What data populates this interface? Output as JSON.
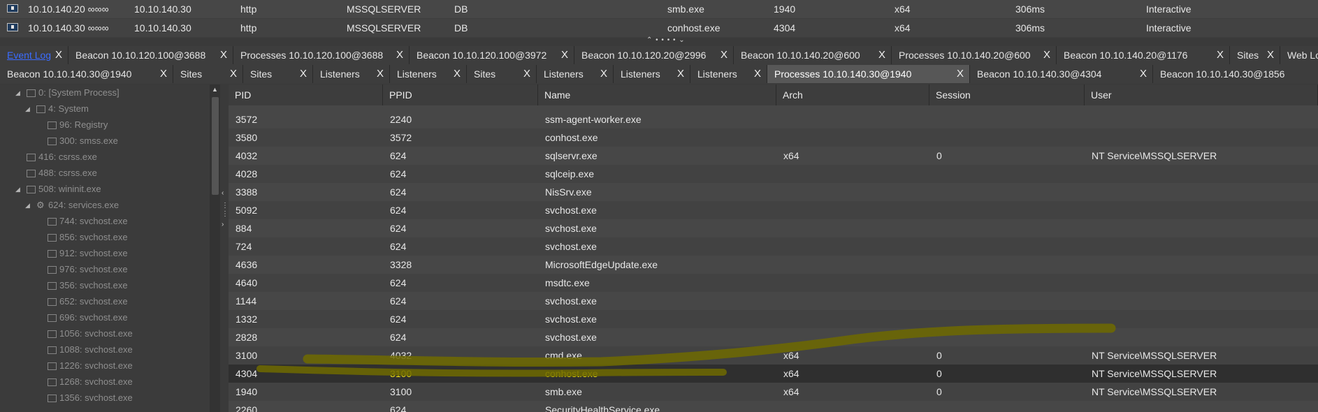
{
  "beacons": [
    {
      "external": "10.10.140.20 ∞∞∞",
      "internal": "10.10.140.30",
      "listener": "http",
      "user": "MSSQLSERVER",
      "computer": "DB",
      "process": "smb.exe",
      "pid": "1940",
      "arch": "x64",
      "last": "306ms",
      "note": "Interactive"
    },
    {
      "external": "10.10.140.30 ∞∞∞",
      "internal": "10.10.140.30",
      "listener": "http",
      "user": "MSSQLSERVER",
      "computer": "DB",
      "process": "conhost.exe",
      "pid": "4304",
      "arch": "x64",
      "last": "306ms",
      "note": "Interactive"
    }
  ],
  "splitter_grip": "⌃ • • • • ⌄",
  "tabs_row1": [
    {
      "label": "Event Log"
    },
    {
      "label": "Beacon 10.10.120.100@3688"
    },
    {
      "label": "Processes 10.10.120.100@3688"
    },
    {
      "label": "Beacon 10.10.120.100@3972"
    },
    {
      "label": "Beacon 10.10.120.20@2996"
    },
    {
      "label": "Beacon 10.10.140.20@600"
    },
    {
      "label": "Processes 10.10.140.20@600"
    },
    {
      "label": "Beacon 10.10.140.20@1176"
    },
    {
      "label": "Sites"
    },
    {
      "label": "Web Log"
    }
  ],
  "tabs_row2": [
    {
      "label": "Beacon 10.10.140.30@1940"
    },
    {
      "label": "Sites"
    },
    {
      "label": "Sites"
    },
    {
      "label": "Listeners"
    },
    {
      "label": "Listeners"
    },
    {
      "label": "Sites"
    },
    {
      "label": "Listeners"
    },
    {
      "label": "Listeners"
    },
    {
      "label": "Listeners"
    },
    {
      "label": "Processes 10.10.140.30@1940"
    },
    {
      "label": "Beacon 10.10.140.30@4304"
    },
    {
      "label": "Beacon 10.10.140.30@1856"
    }
  ],
  "close_glyph": "X",
  "tree": [
    {
      "label": "0: [System Process]",
      "expanded": true
    },
    {
      "label": "4: System",
      "expanded": true
    },
    {
      "label": "96: Registry"
    },
    {
      "label": "300: smss.exe"
    },
    {
      "label": "416: csrss.exe"
    },
    {
      "label": "488: csrss.exe"
    },
    {
      "label": "508: wininit.exe",
      "expanded": true
    },
    {
      "label": "624: services.exe",
      "expanded": true,
      "icon": "gear-icon"
    },
    {
      "label": "744: svchost.exe"
    },
    {
      "label": "856: svchost.exe"
    },
    {
      "label": "912: svchost.exe"
    },
    {
      "label": "976: svchost.exe"
    },
    {
      "label": "356: svchost.exe"
    },
    {
      "label": "652: svchost.exe"
    },
    {
      "label": "696: svchost.exe"
    },
    {
      "label": "1056: svchost.exe"
    },
    {
      "label": "1088: svchost.exe"
    },
    {
      "label": "1226: svchost.exe"
    },
    {
      "label": "1268: svchost.exe"
    },
    {
      "label": "1356: svchost.exe"
    }
  ],
  "process_columns": [
    "PID",
    "PPID",
    "Name",
    "Arch",
    "Session",
    "User"
  ],
  "processes": [
    {
      "pid": "3572",
      "ppid": "2240",
      "name": "ssm-agent-worker.exe",
      "arch": "",
      "session": "",
      "user": ""
    },
    {
      "pid": "3580",
      "ppid": "3572",
      "name": "conhost.exe",
      "arch": "",
      "session": "",
      "user": ""
    },
    {
      "pid": "4032",
      "ppid": "624",
      "name": "sqlservr.exe",
      "arch": "x64",
      "session": "0",
      "user": "NT Service\\MSSQLSERVER"
    },
    {
      "pid": "4028",
      "ppid": "624",
      "name": "sqlceip.exe",
      "arch": "",
      "session": "",
      "user": ""
    },
    {
      "pid": "3388",
      "ppid": "624",
      "name": "NisSrv.exe",
      "arch": "",
      "session": "",
      "user": ""
    },
    {
      "pid": "5092",
      "ppid": "624",
      "name": "svchost.exe",
      "arch": "",
      "session": "",
      "user": ""
    },
    {
      "pid": "884",
      "ppid": "624",
      "name": "svchost.exe",
      "arch": "",
      "session": "",
      "user": ""
    },
    {
      "pid": "724",
      "ppid": "624",
      "name": "svchost.exe",
      "arch": "",
      "session": "",
      "user": ""
    },
    {
      "pid": "4636",
      "ppid": "3328",
      "name": "MicrosoftEdgeUpdate.exe",
      "arch": "",
      "session": "",
      "user": ""
    },
    {
      "pid": "4640",
      "ppid": "624",
      "name": "msdtc.exe",
      "arch": "",
      "session": "",
      "user": ""
    },
    {
      "pid": "1144",
      "ppid": "624",
      "name": "svchost.exe",
      "arch": "",
      "session": "",
      "user": ""
    },
    {
      "pid": "1332",
      "ppid": "624",
      "name": "svchost.exe",
      "arch": "",
      "session": "",
      "user": ""
    },
    {
      "pid": "2828",
      "ppid": "624",
      "name": "svchost.exe",
      "arch": "",
      "session": "",
      "user": ""
    },
    {
      "pid": "3100",
      "ppid": "4032",
      "name": "cmd.exe",
      "arch": "x64",
      "session": "0",
      "user": "NT Service\\MSSQLSERVER"
    },
    {
      "pid": "4304",
      "ppid": "3100",
      "name": "conhost.exe",
      "arch": "x64",
      "session": "0",
      "user": "NT Service\\MSSQLSERVER",
      "selected": true
    },
    {
      "pid": "1940",
      "ppid": "3100",
      "name": "smb.exe",
      "arch": "x64",
      "session": "0",
      "user": "NT Service\\MSSQLSERVER"
    },
    {
      "pid": "2260",
      "ppid": "624",
      "name": "SecurityHealthService.exe",
      "arch": "",
      "session": "",
      "user": ""
    }
  ],
  "colors": {
    "accent_link": "#3b6cff",
    "selected_text": "#f2e20d",
    "annotation_marker": "#6f6a00"
  }
}
